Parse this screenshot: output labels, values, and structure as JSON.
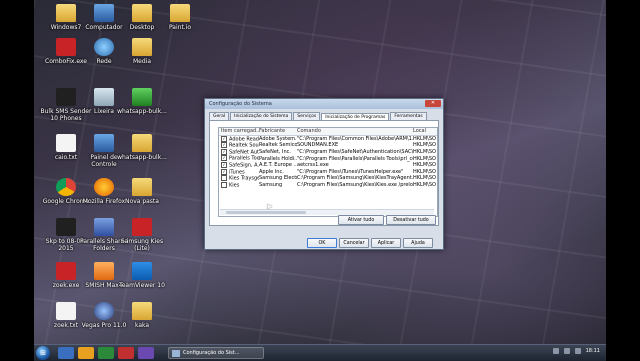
{
  "desktop": {
    "icons": [
      {
        "label": "Windows7",
        "type": "folder"
      },
      {
        "label": "Computador",
        "type": "pc"
      },
      {
        "label": "Desktop",
        "type": "folder"
      },
      {
        "label": "Paint.io",
        "type": "folder"
      },
      {
        "label": "ComboFix.exe",
        "type": "red"
      },
      {
        "label": "Rede",
        "type": "globe"
      },
      {
        "label": "Media",
        "type": "folder"
      },
      {
        "label": "Bulk SMS Sender 10 Phones",
        "type": "black"
      },
      {
        "label": "Lixeira",
        "type": "bin"
      },
      {
        "label": "whatsapp-bulk...",
        "type": "green"
      },
      {
        "label": "caio.txt",
        "type": "doc"
      },
      {
        "label": "Painel de Controle",
        "type": "pc"
      },
      {
        "label": "whatsapp-bulk...",
        "type": "folder"
      },
      {
        "label": "Google Chrome",
        "type": "chrome"
      },
      {
        "label": "Mozilla Firefox",
        "type": "firefox"
      },
      {
        "label": "Nova pasta",
        "type": "folder"
      },
      {
        "label": "Skp to 08-04-2015",
        "type": "black"
      },
      {
        "label": "Parallels Shared Folders",
        "type": "bluegear"
      },
      {
        "label": "Samsung Kies (Lite)",
        "type": "red"
      },
      {
        "label": "zoek.exe",
        "type": "red"
      },
      {
        "label": "SMISH Max4",
        "type": "orange"
      },
      {
        "label": "TeamViewer 10",
        "type": "tv"
      },
      {
        "label": "zoek.txt",
        "type": "doc"
      },
      {
        "label": "Vegas Pro 11.0",
        "type": "vegas"
      },
      {
        "label": "kaka",
        "type": "folder"
      }
    ]
  },
  "dialog": {
    "title": "Configuração do Sistema",
    "close_label": "✕",
    "tabs": [
      "Geral",
      "Inicialização do Sistema",
      "Serviços",
      "Inicialização de Programas",
      "Ferramentas"
    ],
    "active_tab": 3,
    "columns": [
      "Item carregad...",
      "Fabricante",
      "Comando",
      "Local"
    ],
    "rows": [
      {
        "checked": true,
        "item": "Adobe Read...",
        "maker": "Adobe System...",
        "command": "\"C:\\Program Files\\Common Files\\Adobe\\ARM\\1.0\\Adobe...",
        "local": "HKLM\\SO"
      },
      {
        "checked": true,
        "item": "Realtek Sou...",
        "maker": "Realtek Semicon...",
        "command": "SOUNDMAN.EXE",
        "local": "HKLM\\SO"
      },
      {
        "checked": true,
        "item": "SafeNet Aut...",
        "maker": "SafeNet, Inc.",
        "command": "\"C:\\Program Files\\SafeNet\\Authentication\\SAC\\x32\\S...",
        "local": "HKLM\\SO"
      },
      {
        "checked": true,
        "item": "Parallels Too...",
        "maker": "Parallels Holdi...",
        "command": "\"C:\\Program Files\\Parallels\\Parallels Tools\\prl_cc.exe\"",
        "local": "HKLM\\SO"
      },
      {
        "checked": true,
        "item": "SafeSign, A...",
        "maker": "A.E.T. Europe ...",
        "command": "aetcrss1.exe",
        "local": "HKLM\\SO"
      },
      {
        "checked": true,
        "item": "iTunes",
        "maker": "Apple Inc.",
        "command": "\"C:\\Program Files\\iTunes\\iTunesHelper.exe\"",
        "local": "HKLM\\SO"
      },
      {
        "checked": false,
        "item": "Kies Traysgent",
        "maker": "Samsung Electro...",
        "command": "C:\\Program Files\\Samsung\\Kies\\KiesTrayAgent.exe",
        "local": "HKLM\\SO"
      },
      {
        "checked": false,
        "item": "Kies",
        "maker": "Samsung",
        "command": "C:\\Program Files\\Samsung\\Kies\\Kies.exe /preload",
        "local": "HKLM\\SO"
      }
    ],
    "buttons": {
      "enable_all": "Ativar tudo",
      "disable_all": "Desativar tudo",
      "ok": "OK",
      "cancel": "Cancelar",
      "apply": "Aplicar",
      "help": "Ajuda"
    }
  },
  "taskbar": {
    "task_label": "Configuração do Sist...",
    "clock": "18:11"
  }
}
